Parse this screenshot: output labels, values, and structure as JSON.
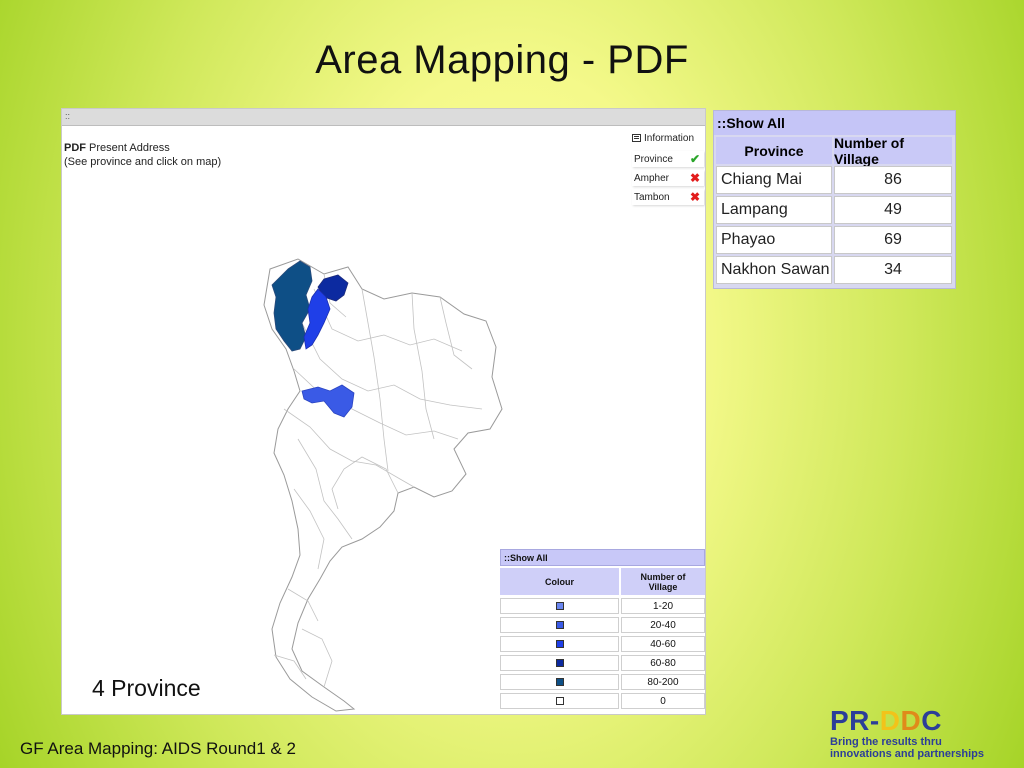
{
  "slide": {
    "title": "Area Mapping - PDF",
    "footer": "GF Area Mapping: AIDS Round1 & 2"
  },
  "map_panel": {
    "topbar": "::",
    "heading_bold": "PDF",
    "heading_rest": " Present Address",
    "subheading": "(See province and click on map)",
    "info_label": "Information",
    "info_icon": "information-icon",
    "layers": [
      {
        "label": "Province",
        "status": "✔",
        "active": true
      },
      {
        "label": "Ampher",
        "status": "✖",
        "active": false
      },
      {
        "label": "Tambon",
        "status": "✖",
        "active": false
      }
    ],
    "province_count_label": "4 Province"
  },
  "legend": {
    "title": "::Show All",
    "col_colour": "Colour",
    "col_villages_line1": "Number of",
    "col_villages_line2": "Village",
    "rows": [
      {
        "range": "1-20",
        "color": "#6a86f0"
      },
      {
        "range": "20-40",
        "color": "#3a5ae6"
      },
      {
        "range": "40-60",
        "color": "#1f3fe8"
      },
      {
        "range": "60-80",
        "color": "#0c2aa0"
      },
      {
        "range": "80-200",
        "color": "#0e4f86"
      },
      {
        "range": "0",
        "color": "#ffffff"
      }
    ]
  },
  "summary": {
    "title": "::Show All",
    "col_province": "Province",
    "col_villages": "Number of Village",
    "rows": [
      {
        "province": "Chiang Mai",
        "villages": "86"
      },
      {
        "province": "Lampang",
        "villages": "49"
      },
      {
        "province": "Phayao",
        "villages": "69"
      },
      {
        "province": "Nakhon Sawan",
        "villages": "34"
      }
    ]
  },
  "logo": {
    "mark_part1": "PR-",
    "mark_part2": "D",
    "mark_part3": "D",
    "mark_part4": "C",
    "tagline_line1": "Bring the results thru",
    "tagline_line2": "innovations and partnerships"
  },
  "colors": {
    "chiang_mai": "#0e4f86",
    "lampang": "#1f3fe8",
    "phayao": "#0c2aa0",
    "nakhon_sawan": "#3a5ae6"
  }
}
